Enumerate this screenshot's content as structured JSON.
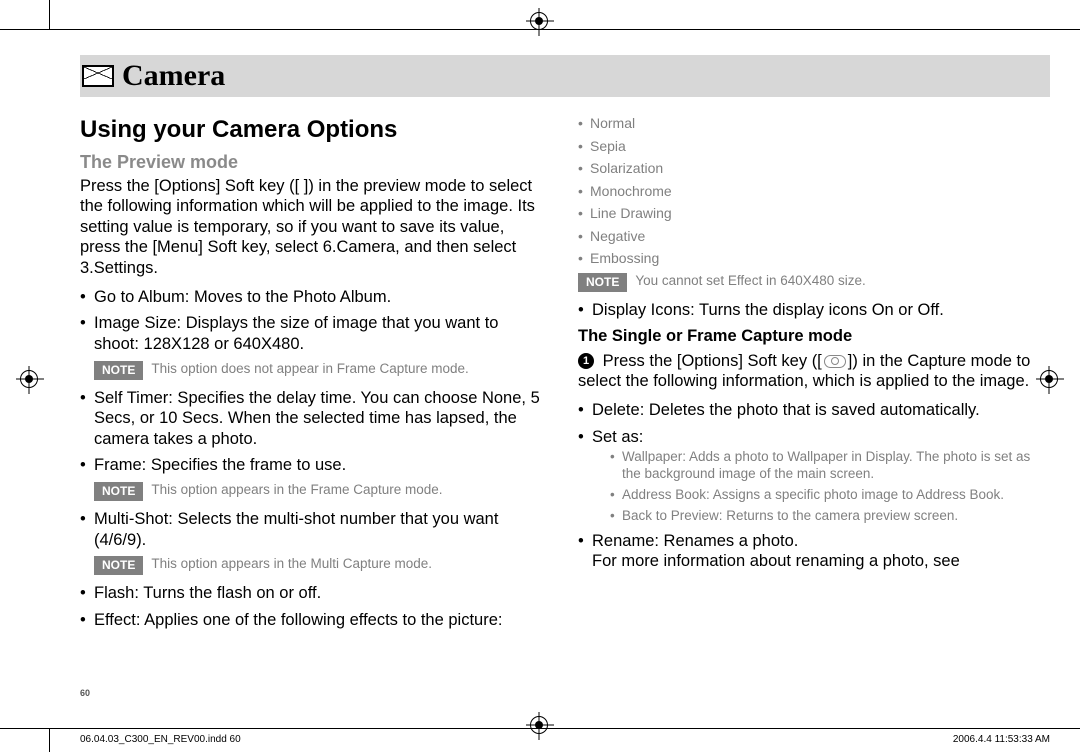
{
  "header": {
    "title": "Camera"
  },
  "left": {
    "h1": "Using your Camera Options",
    "h2": "The Preview mode",
    "intro": "Press the [Options] Soft key ([    ]) in the preview mode to select the following information which will be applied to the image. Its setting value is temporary, so if you want to save its value, press the [Menu] Soft key, select 6.Camera, and then select 3.Settings.",
    "b1": "Go to Album: Moves to the Photo Album.",
    "b2": "Image Size: Displays the size of image that you want to shoot: 128X128 or 640X480.",
    "note_lab": "NOTE",
    "note1": "This option does not appear in Frame Capture mode.",
    "b3": "Self Timer: Specifies the delay time. You can choose None, 5 Secs, or 10 Secs. When the selected time has lapsed, the camera takes a photo.",
    "b4": "Frame: Specifies the frame to use.",
    "note2": "This option appears in the Frame Capture mode.",
    "b5": "Multi-Shot: Selects the multi-shot number that you want (4/6/9).",
    "note3": "This option appears in the Multi Capture mode.",
    "b6": "Flash: Turns the flash on or off.",
    "b7": "Effect: Applies one of the following effects to the picture:"
  },
  "right": {
    "effects": [
      "Normal",
      "Sepia",
      "Solarization",
      "Monochrome",
      "Line Drawing",
      "Negative",
      "Embossing"
    ],
    "note4": "You cannot set Effect in 640X480 size.",
    "b1": "Display Icons: Turns the display icons On or Off.",
    "h3": "The Single or Frame Capture mode",
    "cap1_a": "Press the [Options] Soft key ([",
    "cap1_b": "]) in the Capture mode to select the following information, which is applied to the image.",
    "b2": "Delete: Deletes the photo that is saved automatically.",
    "b3": "Set as:",
    "sub1": "Wallpaper: Adds a photo to Wallpaper in Display. The photo is set as the background image of the main screen.",
    "sub2": "Address Book: Assigns a specific photo image to Address Book.",
    "sub3": "Back to Preview: Returns to the camera preview screen.",
    "b4": "Rename: Renames a photo.\nFor more information about renaming a photo, see"
  },
  "pagenum": "60",
  "footer": {
    "left": "06.04.03_C300_EN_REV00.indd   60",
    "right": "2006.4.4   11:53:33 AM"
  }
}
